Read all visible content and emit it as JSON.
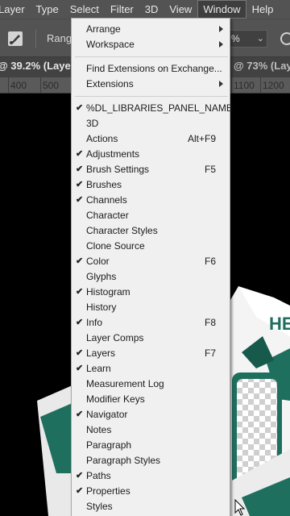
{
  "menubar": {
    "items": [
      "Layer",
      "Type",
      "Select",
      "Filter",
      "3D",
      "View",
      "Window",
      "Help"
    ],
    "active_index": 6
  },
  "options": {
    "label": "Rang",
    "percent": "%"
  },
  "tabs": {
    "doc1": "@ 39.2% (Laye",
    "doc2": "@ 73% (Layer"
  },
  "ruler": {
    "left_ticks": [
      "400",
      "500"
    ],
    "right_ticks": [
      "1100",
      "1200"
    ]
  },
  "window_menu": {
    "items": [
      {
        "label": "Arrange",
        "submenu": true,
        "checked": false,
        "shortcut": ""
      },
      {
        "label": "Workspace",
        "submenu": true,
        "checked": false,
        "shortcut": ""
      },
      {
        "label": "Find Extensions on Exchange...",
        "submenu": false,
        "checked": false,
        "shortcut": ""
      },
      {
        "label": "Extensions",
        "submenu": true,
        "checked": false,
        "shortcut": ""
      },
      {
        "label": "%DL_LIBRARIES_PANEL_NAME",
        "submenu": false,
        "checked": true,
        "shortcut": ""
      },
      {
        "label": "3D",
        "submenu": false,
        "checked": false,
        "shortcut": ""
      },
      {
        "label": "Actions",
        "submenu": false,
        "checked": false,
        "shortcut": "Alt+F9"
      },
      {
        "label": "Adjustments",
        "submenu": false,
        "checked": true,
        "shortcut": ""
      },
      {
        "label": "Brush Settings",
        "submenu": false,
        "checked": true,
        "shortcut": "F5"
      },
      {
        "label": "Brushes",
        "submenu": false,
        "checked": true,
        "shortcut": ""
      },
      {
        "label": "Channels",
        "submenu": false,
        "checked": true,
        "shortcut": ""
      },
      {
        "label": "Character",
        "submenu": false,
        "checked": false,
        "shortcut": ""
      },
      {
        "label": "Character Styles",
        "submenu": false,
        "checked": false,
        "shortcut": ""
      },
      {
        "label": "Clone Source",
        "submenu": false,
        "checked": false,
        "shortcut": ""
      },
      {
        "label": "Color",
        "submenu": false,
        "checked": true,
        "shortcut": "F6"
      },
      {
        "label": "Glyphs",
        "submenu": false,
        "checked": false,
        "shortcut": ""
      },
      {
        "label": "Histogram",
        "submenu": false,
        "checked": true,
        "shortcut": ""
      },
      {
        "label": "History",
        "submenu": false,
        "checked": false,
        "shortcut": ""
      },
      {
        "label": "Info",
        "submenu": false,
        "checked": true,
        "shortcut": "F8"
      },
      {
        "label": "Layer Comps",
        "submenu": false,
        "checked": false,
        "shortcut": ""
      },
      {
        "label": "Layers",
        "submenu": false,
        "checked": true,
        "shortcut": "F7"
      },
      {
        "label": "Learn",
        "submenu": false,
        "checked": true,
        "shortcut": ""
      },
      {
        "label": "Measurement Log",
        "submenu": false,
        "checked": false,
        "shortcut": ""
      },
      {
        "label": "Modifier Keys",
        "submenu": false,
        "checked": false,
        "shortcut": ""
      },
      {
        "label": "Navigator",
        "submenu": false,
        "checked": true,
        "shortcut": ""
      },
      {
        "label": "Notes",
        "submenu": false,
        "checked": false,
        "shortcut": ""
      },
      {
        "label": "Paragraph",
        "submenu": false,
        "checked": false,
        "shortcut": ""
      },
      {
        "label": "Paragraph Styles",
        "submenu": false,
        "checked": false,
        "shortcut": ""
      },
      {
        "label": "Paths",
        "submenu": false,
        "checked": true,
        "shortcut": ""
      },
      {
        "label": "Properties",
        "submenu": false,
        "checked": true,
        "shortcut": ""
      },
      {
        "label": "Styles",
        "submenu": false,
        "checked": false,
        "shortcut": ""
      }
    ]
  },
  "canvas": {
    "box_text": "HE"
  },
  "colors": {
    "menubar_bg": "#535353",
    "menu_bg": "#f0f0f0",
    "accent_green": "#1f6f5e"
  }
}
